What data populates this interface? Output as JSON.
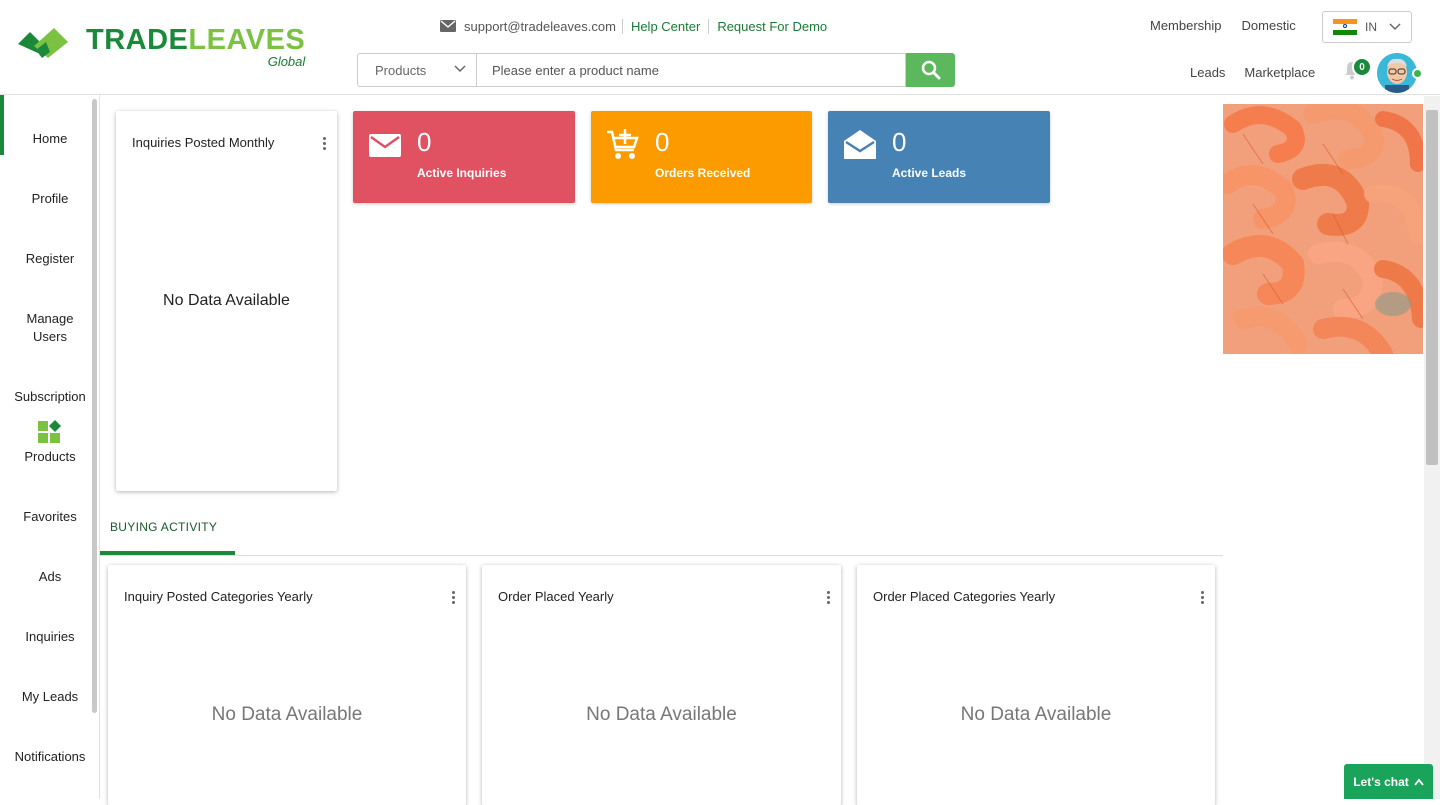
{
  "brand": {
    "title_part1": "TRADE",
    "title_part2": "LEAVES",
    "subtitle": "Global"
  },
  "header": {
    "email": "support@tradeleaves.com",
    "help_center": "Help Center",
    "request_demo": "Request For Demo",
    "search_category": "Products",
    "search_placeholder": "Please enter a product name",
    "membership": "Membership",
    "domestic": "Domestic",
    "language": "IN",
    "leads": "Leads",
    "marketplace": "Marketplace",
    "notification_count": "0"
  },
  "sidebar": {
    "items": [
      "Home",
      "Profile",
      "Register",
      "Manage Users",
      "Subscription",
      "Products",
      "Favorites",
      "Ads",
      "Inquiries",
      "My Leads",
      "Notifications"
    ],
    "active": "Home"
  },
  "cards": {
    "monthly": {
      "title": "Inquiries Posted Monthly",
      "empty": "No Data Available"
    },
    "stats": [
      {
        "value": "0",
        "label": "Active Inquiries",
        "color": "#e05262",
        "icon": "envelope-icon"
      },
      {
        "value": "0",
        "label": "Orders Received",
        "color": "#fb9b00",
        "icon": "cart-icon"
      },
      {
        "value": "0",
        "label": "Active Leads",
        "color": "#4682b4",
        "icon": "open-envelope-icon"
      }
    ],
    "tab": "BUYING ACTIVITY",
    "yearly": [
      {
        "title": "Inquiry Posted Categories Yearly",
        "empty": "No Data Available"
      },
      {
        "title": "Order Placed Yearly",
        "empty": "No Data Available"
      },
      {
        "title": "Order Placed Categories Yearly",
        "empty": "No Data Available"
      }
    ]
  },
  "chat": {
    "label": "Let's chat"
  },
  "colors": {
    "brand_green": "#1a8a3a",
    "brand_light_green": "#7cc242",
    "search_button": "#5cb85c"
  }
}
